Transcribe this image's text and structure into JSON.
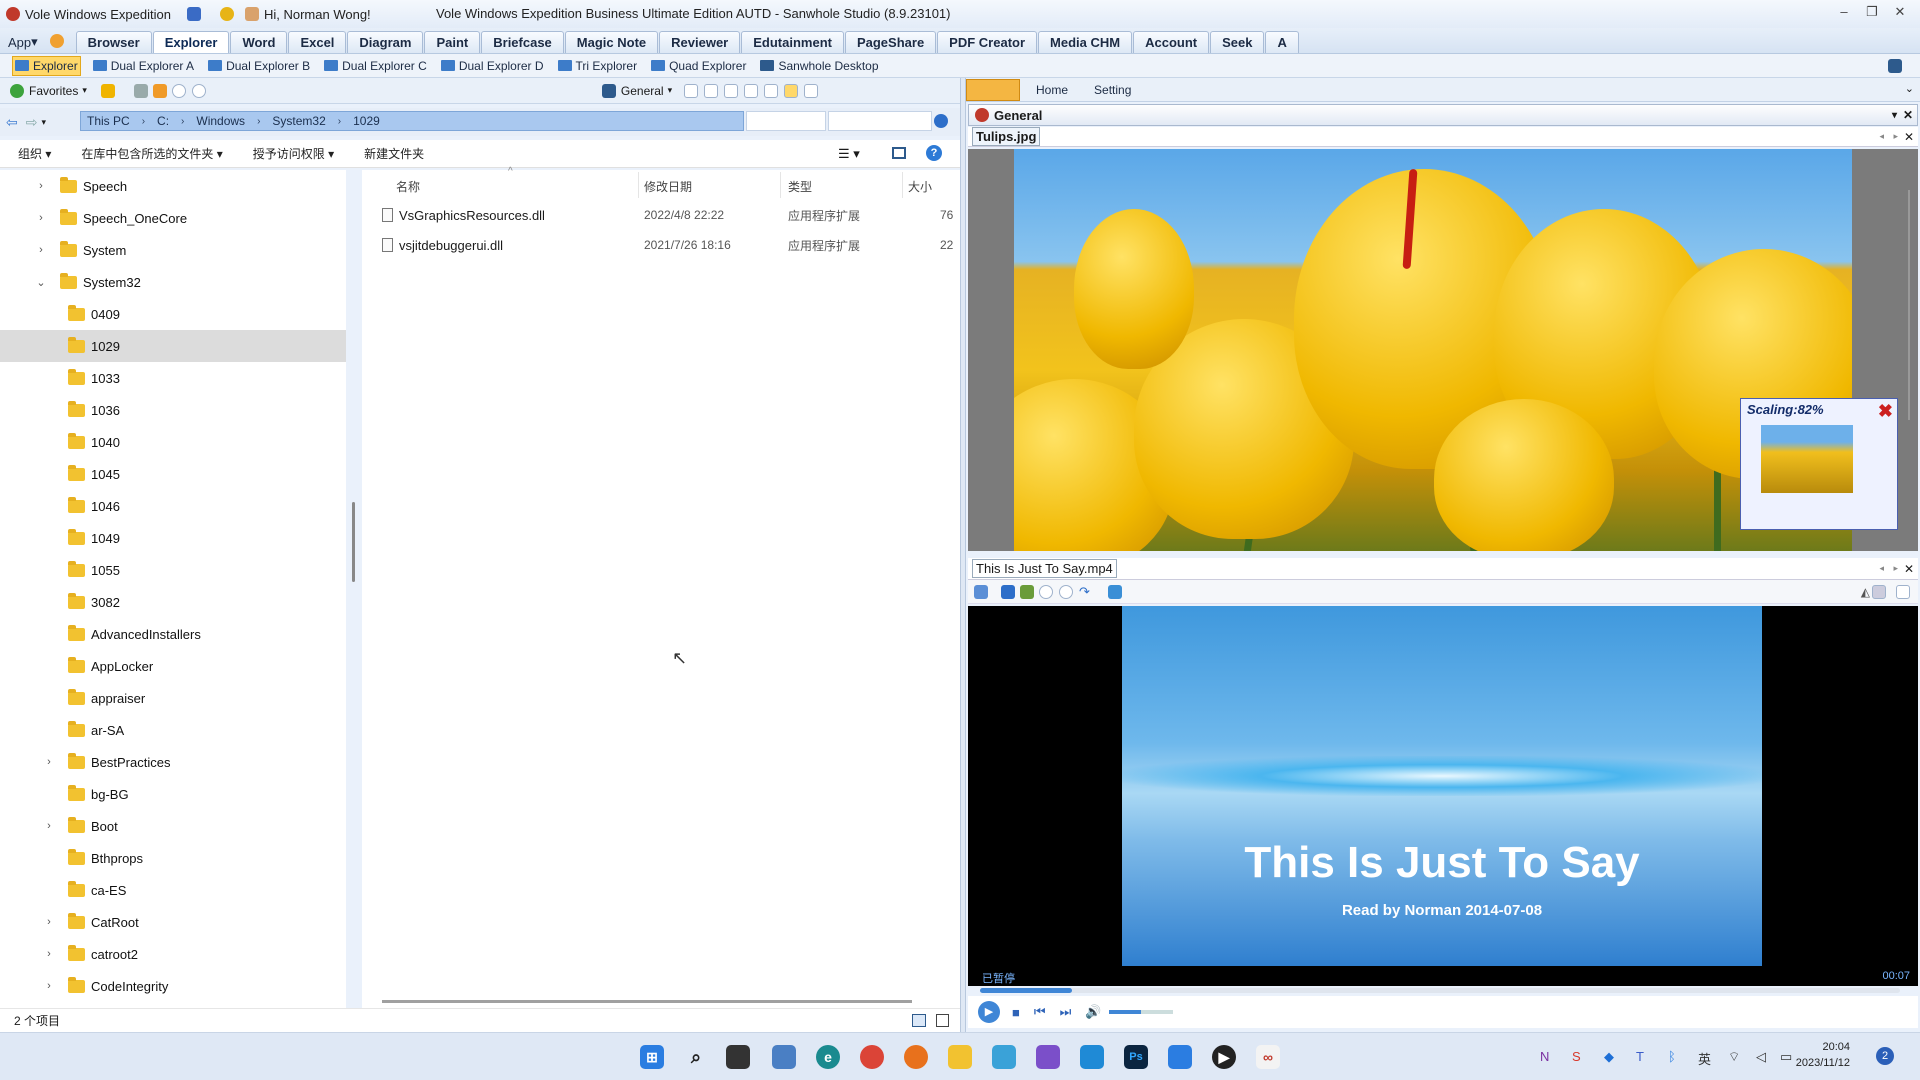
{
  "titlebar": {
    "app_name": "Vole Windows Expedition",
    "greeting": "Hi, Norman Wong!",
    "window_title": "Vole Windows Expedition Business Ultimate Edition AUTD - Sanwhole Studio (8.9.23101)"
  },
  "menubar": {
    "app_menu": "App",
    "tabs": [
      "Browser",
      "Explorer",
      "Word",
      "Excel",
      "Diagram",
      "Paint",
      "Briefcase",
      "Magic Note",
      "Reviewer",
      "Edutainment",
      "PageShare",
      "PDF Creator",
      "Media CHM",
      "Account",
      "Seek",
      "A"
    ],
    "active_tab": "Explorer"
  },
  "subbar": {
    "items": [
      "Explorer",
      "Dual Explorer A",
      "Dual Explorer B",
      "Dual Explorer C",
      "Dual Explorer D",
      "Tri Explorer",
      "Quad Explorer",
      "Sanwhole Desktop"
    ]
  },
  "favbar": {
    "favorites": "Favorites",
    "general": "General"
  },
  "address": {
    "crumbs": [
      "This PC",
      "C:",
      "Windows",
      "System32",
      "1029"
    ]
  },
  "commands": {
    "organize": "组织",
    "include_library": "在库中包含所选的文件夹",
    "grant_access": "授予访问权限",
    "new_folder": "新建文件夹"
  },
  "tree": {
    "items": [
      {
        "label": "Speech",
        "depth": 0,
        "expand": ">"
      },
      {
        "label": "Speech_OneCore",
        "depth": 0,
        "expand": ">"
      },
      {
        "label": "System",
        "depth": 0,
        "expand": ">"
      },
      {
        "label": "System32",
        "depth": 0,
        "expand": "v"
      },
      {
        "label": "0409",
        "depth": 1,
        "expand": ""
      },
      {
        "label": "1029",
        "depth": 1,
        "expand": "",
        "selected": true
      },
      {
        "label": "1033",
        "depth": 1,
        "expand": ""
      },
      {
        "label": "1036",
        "depth": 1,
        "expand": ""
      },
      {
        "label": "1040",
        "depth": 1,
        "expand": ""
      },
      {
        "label": "1045",
        "depth": 1,
        "expand": ""
      },
      {
        "label": "1046",
        "depth": 1,
        "expand": ""
      },
      {
        "label": "1049",
        "depth": 1,
        "expand": ""
      },
      {
        "label": "1055",
        "depth": 1,
        "expand": ""
      },
      {
        "label": "3082",
        "depth": 1,
        "expand": ""
      },
      {
        "label": "AdvancedInstallers",
        "depth": 1,
        "expand": ""
      },
      {
        "label": "AppLocker",
        "depth": 1,
        "expand": ""
      },
      {
        "label": "appraiser",
        "depth": 1,
        "expand": ""
      },
      {
        "label": "ar-SA",
        "depth": 1,
        "expand": ""
      },
      {
        "label": "BestPractices",
        "depth": 1,
        "expand": ">"
      },
      {
        "label": "bg-BG",
        "depth": 1,
        "expand": ""
      },
      {
        "label": "Boot",
        "depth": 1,
        "expand": ">"
      },
      {
        "label": "Bthprops",
        "depth": 1,
        "expand": ""
      },
      {
        "label": "ca-ES",
        "depth": 1,
        "expand": ""
      },
      {
        "label": "CatRoot",
        "depth": 1,
        "expand": ">"
      },
      {
        "label": "catroot2",
        "depth": 1,
        "expand": ">"
      },
      {
        "label": "CodeIntegrity",
        "depth": 1,
        "expand": ">"
      }
    ]
  },
  "filelist": {
    "columns": {
      "name": "名称",
      "modified": "修改日期",
      "type": "类型",
      "size": "大小"
    },
    "rows": [
      {
        "name": "VsGraphicsResources.dll",
        "modified": "2022/4/8 22:22",
        "type": "应用程序扩展",
        "size": "76"
      },
      {
        "name": "vsjitdebuggerui.dll",
        "modified": "2021/7/26 18:16",
        "type": "应用程序扩展",
        "size": "22"
      }
    ]
  },
  "status": {
    "count": "2 个项目"
  },
  "rightpane": {
    "tabs": [
      "Home",
      "Setting"
    ],
    "general_header": "General",
    "image_tab": "Tulips.jpg",
    "scaling_label": "Scaling:82%",
    "video_tab": "This Is Just To Say.mp4",
    "video_title": "This Is Just To Say",
    "video_subtitle": "Read by Norman 2014-07-08",
    "video_status": "已暂停",
    "video_time": "00:07",
    "video_progress": 0.1,
    "volume_level": 0.5
  },
  "taskbar": {
    "icons": [
      "windows-start-icon",
      "search-icon",
      "task-view-icon",
      "chart-app-icon",
      "edge-icon",
      "chrome-icon",
      "firefox-icon",
      "file-explorer-icon",
      "app-grid-icon",
      "visual-studio-icon",
      "vscode-icon",
      "photoshop-icon",
      "paint-icon",
      "media-player-icon",
      "vole-icon"
    ],
    "ime": "英",
    "time": "20:04",
    "date": "2023/11/12",
    "notifications": "2"
  }
}
